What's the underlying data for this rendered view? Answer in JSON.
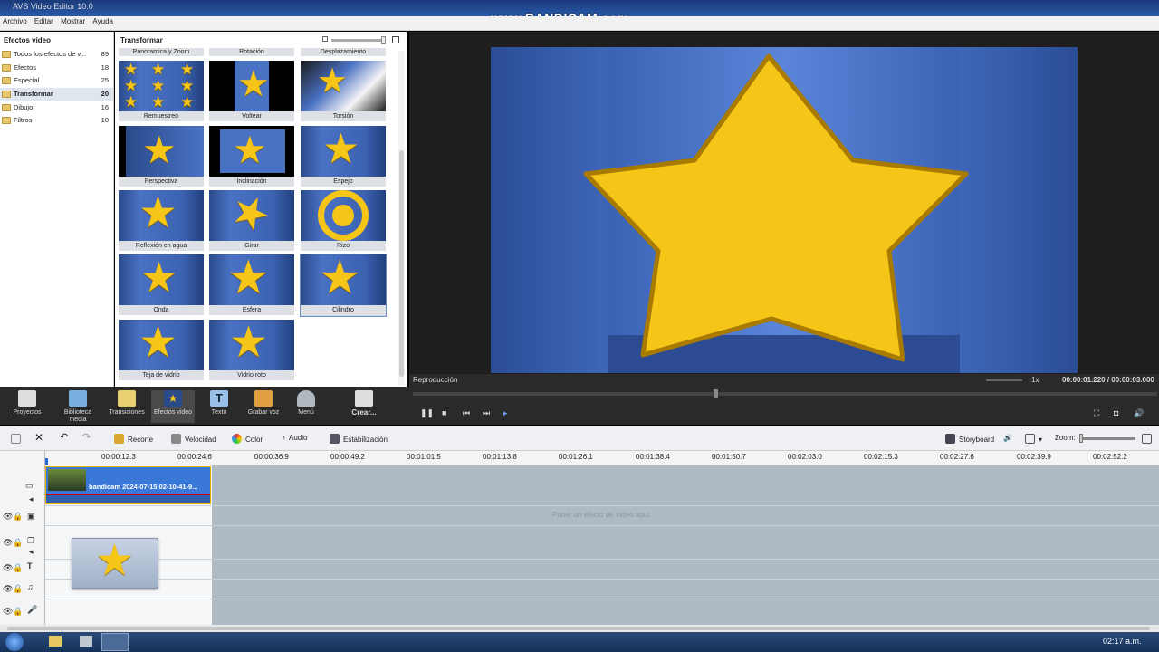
{
  "window": {
    "title": "AVS Video Editor 10.0",
    "recorder_watermark": "www.BANDICAM.com"
  },
  "menu": [
    "Archivo",
    "Editar",
    "Mostrar",
    "Ayuda"
  ],
  "left_panel": {
    "title": "Efectos video",
    "categories": [
      {
        "label": "Todos los efectos de v...",
        "count": "89"
      },
      {
        "label": "Efectos",
        "count": "18"
      },
      {
        "label": "Especial",
        "count": "25"
      },
      {
        "label": "Transformar",
        "count": "20"
      },
      {
        "label": "Dibujo",
        "count": "16"
      },
      {
        "label": "Filtros",
        "count": "10"
      }
    ]
  },
  "grid": {
    "title": "Transformar",
    "top_labels": [
      "Panoramica y Zoom",
      "Rotación",
      "Desplazamiento"
    ],
    "tiles": [
      {
        "label": "Remuestreo"
      },
      {
        "label": "Voltear"
      },
      {
        "label": "Torsión"
      },
      {
        "label": "Perspectiva"
      },
      {
        "label": "Inclinación"
      },
      {
        "label": "Espejo"
      },
      {
        "label": "Reflexión en agua"
      },
      {
        "label": "Girar"
      },
      {
        "label": "Rizo"
      },
      {
        "label": "Onda"
      },
      {
        "label": "Esfera"
      },
      {
        "label": "Cilindro"
      },
      {
        "label": "Teja de vidrio"
      },
      {
        "label": "Vidrio roto"
      }
    ],
    "selected": "Cilindro"
  },
  "preview": {
    "label": "Reproducción",
    "speed": "1x",
    "time": "00:00:01.220 / 00:00:03.000"
  },
  "toolbar": [
    {
      "label": "Proyectos"
    },
    {
      "label": "Biblioteca media"
    },
    {
      "label": "Transiciones"
    },
    {
      "label": "Efectos video"
    },
    {
      "label": "Texto"
    },
    {
      "label": "Grabar voz"
    },
    {
      "label": "Menú"
    },
    {
      "label": "Crear..."
    }
  ],
  "timeline_toolbar": {
    "recorte": "Recorte",
    "velocidad": "Velocidad",
    "color": "Color",
    "audio": "Audio",
    "estabilizacion": "Estabilización",
    "storyboard": "Storyboard",
    "zoom": "Zoom:"
  },
  "ruler": [
    "00:00:12.3",
    "00:00:24.6",
    "00:00:36.9",
    "00:00:49.2",
    "00:01:01.5",
    "00:01:13.8",
    "00:01:26.1",
    "00:01:38.4",
    "00:01:50.7",
    "00:02:03.0",
    "00:02:15.3",
    "00:02:27.6",
    "00:02:39.9",
    "00:02:52.2"
  ],
  "clip": {
    "name": "bandicam 2024-07-15 02-10-41-9..."
  },
  "effect_hint": "Poner un efecto de vídeo aquí",
  "taskbar": {
    "clock": "02:17 a.m."
  },
  "colors": {
    "accent": "#3a78d8",
    "star": "#f5c518",
    "toolbar_bg": "#2a2a2a"
  }
}
